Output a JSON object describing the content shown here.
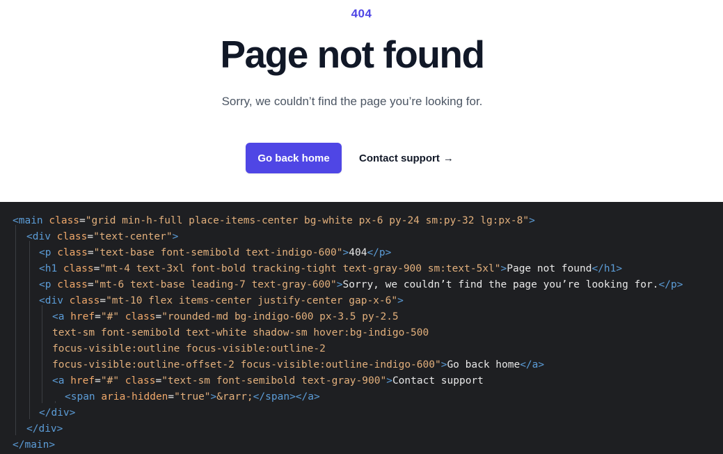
{
  "preview": {
    "code": "404",
    "title": "Page not found",
    "subtitle": "Sorry, we couldn’t find the page you’re looking for.",
    "primary_button": "Go back home",
    "secondary_link": "Contact support",
    "secondary_link_arrow": "→",
    "colors": {
      "accent": "#4f46e5",
      "heading": "#111827",
      "body": "#4b5563"
    }
  },
  "code_editor": {
    "background": "#1e1f22",
    "lines": [
      [
        "<",
        "main",
        " class",
        "=",
        "\"grid min-h-full place-items-center bg-white px-6 py-24 sm:py-32 lg:px-8\"",
        ">"
      ],
      [
        "<",
        "div",
        " class",
        "=",
        "\"text-center\"",
        ">"
      ],
      [
        "<",
        "p",
        " class",
        "=",
        "\"text-base font-semibold text-indigo-600\"",
        ">",
        "404",
        "</",
        "p",
        ">"
      ],
      [
        "<",
        "h1",
        " class",
        "=",
        "\"mt-4 text-3xl font-bold tracking-tight text-gray-900 sm:text-5xl\"",
        ">",
        "Page not found",
        "</",
        "h1",
        ">"
      ],
      [
        "<",
        "p",
        " class",
        "=",
        "\"mt-6 text-base leading-7 text-gray-600\"",
        ">",
        "Sorry, we couldn’t find the page you’re looking for.",
        "</",
        "p",
        ">"
      ],
      [
        "<",
        "div",
        " class",
        "=",
        "\"mt-10 flex items-center justify-center gap-x-6\"",
        ">"
      ],
      [
        "<",
        "a",
        " href",
        "=",
        "\"#\"",
        " class",
        "=",
        "\"rounded-md bg-indigo-600 px-3.5 py-2.5"
      ],
      [
        "text-sm font-semibold text-white shadow-sm hover:bg-indigo-500"
      ],
      [
        "focus-visible:outline focus-visible:outline-2"
      ],
      [
        "focus-visible:outline-offset-2 focus-visible:outline-indigo-600\"",
        ">",
        "Go back home",
        "</",
        "a",
        ">"
      ],
      [
        "<",
        "a",
        " href",
        "=",
        "\"#\"",
        " class",
        "=",
        "\"text-sm font-semibold text-gray-900\"",
        ">",
        "Contact support"
      ],
      [
        "<",
        "span",
        " aria-hidden",
        "=",
        "\"true\"",
        ">",
        "&rarr;",
        "</",
        "span",
        "></",
        "a",
        ">"
      ],
      [
        "</",
        "div",
        ">"
      ],
      [
        "</",
        "div",
        ">"
      ],
      [
        "</",
        "main",
        ">"
      ]
    ]
  }
}
